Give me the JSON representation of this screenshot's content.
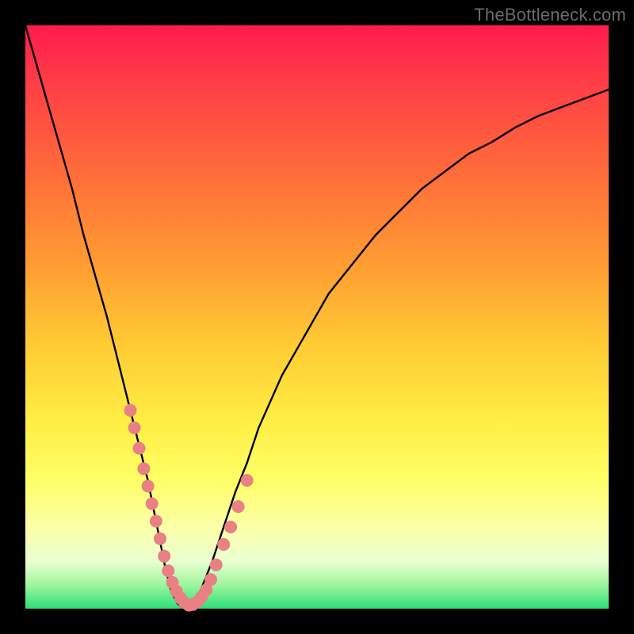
{
  "watermark": "TheBottleneck.com",
  "chart_data": {
    "type": "line",
    "title": "",
    "xlabel": "",
    "ylabel": "",
    "xlim": [
      0,
      100
    ],
    "ylim": [
      0,
      100
    ],
    "x": [
      0,
      2,
      4,
      6,
      8,
      10,
      12,
      14,
      16,
      18,
      20,
      21,
      22,
      23,
      24,
      25,
      26,
      27,
      28,
      29,
      30,
      32,
      34,
      36,
      38,
      40,
      44,
      48,
      52,
      56,
      60,
      64,
      68,
      72,
      76,
      80,
      84,
      88,
      92,
      96,
      100
    ],
    "values": [
      100,
      93,
      86,
      79,
      72,
      64,
      57,
      50,
      42,
      34,
      26,
      22,
      17,
      12,
      7,
      3,
      1,
      0,
      0,
      1,
      3,
      8,
      14,
      20,
      25,
      31,
      40,
      47,
      54,
      59,
      64,
      68,
      72,
      75,
      78,
      80,
      82.5,
      84.5,
      86,
      87.5,
      89
    ],
    "markers_x": [
      18,
      18.7,
      19.5,
      20.3,
      21,
      21.7,
      22.4,
      23.1,
      23.8,
      24.5,
      25.2,
      25.9,
      26.6,
      27.3,
      28.0,
      28.7,
      29.5,
      30.2,
      31,
      31.8,
      32.7,
      34,
      35.2,
      36.5,
      38
    ],
    "markers_y": [
      34,
      31,
      27.5,
      24,
      21,
      18,
      15,
      12,
      9,
      6.5,
      4.5,
      3,
      1.8,
      1,
      0.6,
      0.7,
      1.2,
      2,
      3.2,
      5,
      7.5,
      11,
      14,
      17.5,
      22
    ],
    "marker_color": "#e98083",
    "curve_color": "#000000"
  }
}
